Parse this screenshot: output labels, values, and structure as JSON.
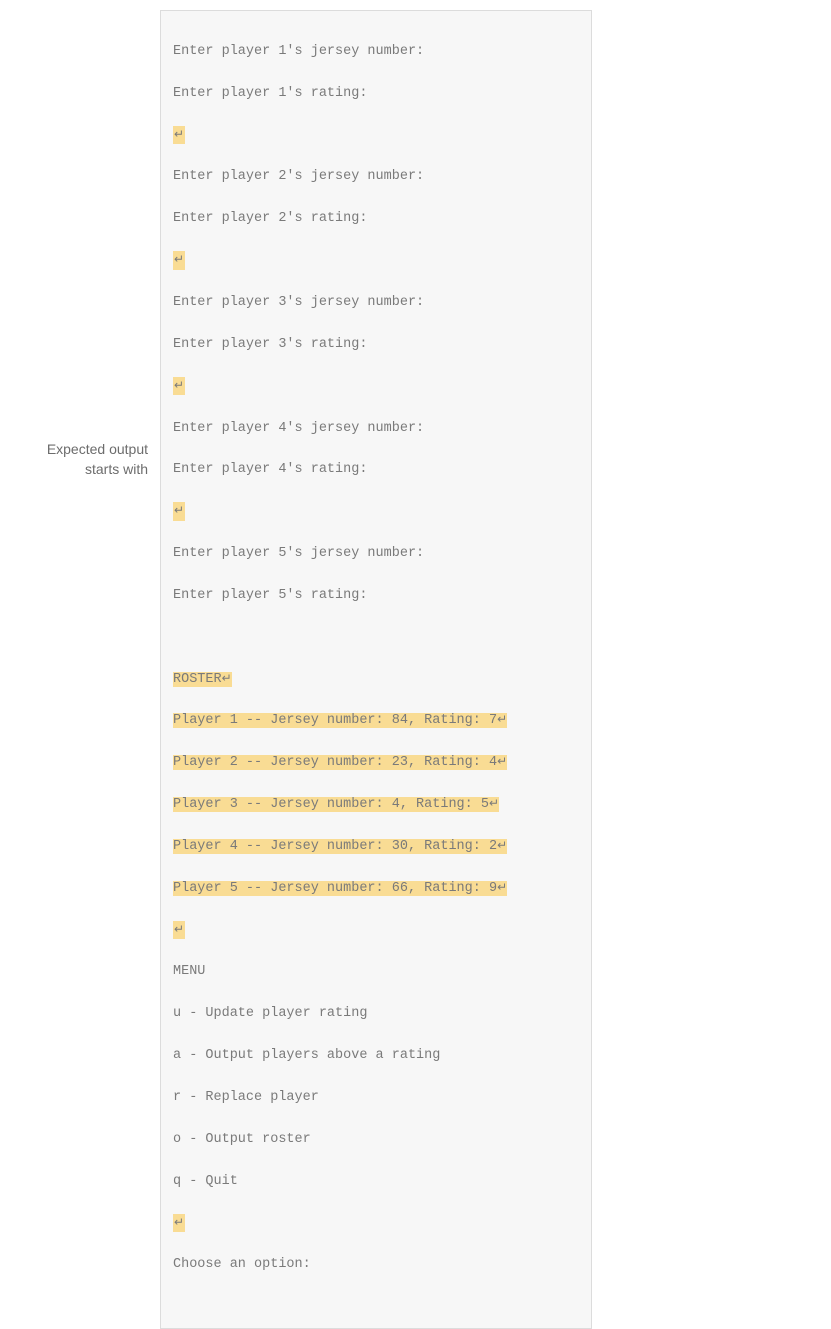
{
  "label": {
    "line1": "Expected output",
    "line2": "starts with"
  },
  "return_glyph": "↵",
  "prompts": {
    "p1_jersey": "Enter player 1's jersey number:",
    "p1_rating": "Enter player 1's rating:",
    "p2_jersey": "Enter player 2's jersey number:",
    "p2_rating": "Enter player 2's rating:",
    "p3_jersey": "Enter player 3's jersey number:",
    "p3_rating": "Enter player 3's rating:",
    "p4_jersey": "Enter player 4's jersey number:",
    "p4_rating": "Enter player 4's rating:",
    "p5_jersey": "Enter player 5's jersey number:",
    "p5_rating": "Enter player 5's rating:"
  },
  "roster": {
    "header": "ROSTER",
    "rows": [
      "Player 1 -- Jersey number: 84, Rating: 7",
      "Player 2 -- Jersey number: 23, Rating: 4",
      "Player 3 -- Jersey number: 4, Rating: 5",
      "Player 4 -- Jersey number: 30, Rating: 2",
      "Player 5 -- Jersey number: 66, Rating: 9"
    ]
  },
  "menu": {
    "header": "MENU",
    "items": [
      "u - Update player rating",
      "a - Output players above a rating",
      "r - Replace player",
      "o - Output roster",
      "q - Quit"
    ],
    "choose": "Choose an option:"
  }
}
